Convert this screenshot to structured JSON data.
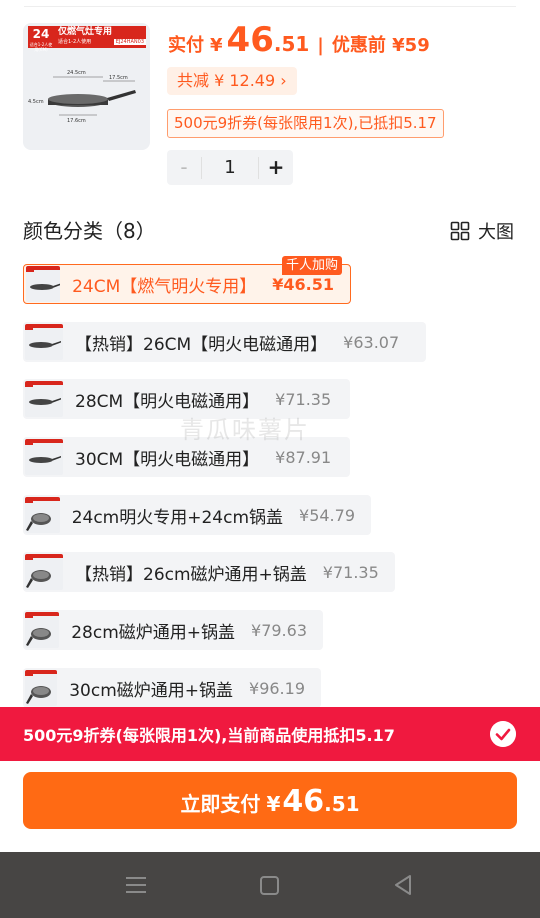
{
  "product": {
    "image": {
      "badge_number": "24",
      "badge_sub": "适合1-2人使用(CM)",
      "banner_title": "仅燃气灶专用",
      "banner_sub": "适合1-2人使用",
      "code": "EJ24HAN03",
      "dim_top": "24.5cm",
      "dim_handle": "17.5cm",
      "dim_bottom": "17.6cm",
      "dim_height": "4.5cm"
    },
    "pay_label": "实付",
    "currency": "¥",
    "pay_int": "46",
    "pay_dec": ".51",
    "separator": "|",
    "pre_discount": "优惠前 ¥59",
    "saved": "共减 ¥ 12.49 ›",
    "coupon": "500元9折券(每张限用1次),已抵扣5.17",
    "quantity": {
      "minus": "-",
      "value": "1",
      "plus": "+"
    }
  },
  "section": {
    "title": "颜色分类（8）",
    "big_image_label": "大图"
  },
  "options": [
    {
      "name": "24CM【燃气明火专用】",
      "price": "¥46.51",
      "tag": "千人加购",
      "selected": true
    },
    {
      "name": "【热销】26CM【明火电磁通用】",
      "price": "¥63.07"
    },
    {
      "name": "28CM【明火电磁通用】",
      "price": "¥71.35"
    },
    {
      "name": "30CM【明火电磁通用】",
      "price": "¥87.91"
    },
    {
      "name": "24cm明火专用+24cm锅盖",
      "price": "¥54.79"
    },
    {
      "name": "【热销】26cm磁炉通用+锅盖",
      "price": "¥71.35"
    },
    {
      "name": "28cm磁炉通用+锅盖",
      "price": "¥79.63"
    },
    {
      "name": "30cm磁炉通用+锅盖",
      "price": "¥96.19"
    }
  ],
  "watermark": "青瓜味薯片",
  "coupon_bar": {
    "text": "500元9折券(每张限用1次),当前商品使用抵扣5.17"
  },
  "pay_button": {
    "label": "立即支付",
    "currency": "¥",
    "int": "46",
    "dec": ".51"
  },
  "colors": {
    "accent": "#ff5a1f",
    "coupon_bar": "#f0193f",
    "nav_bar": "#474544"
  }
}
